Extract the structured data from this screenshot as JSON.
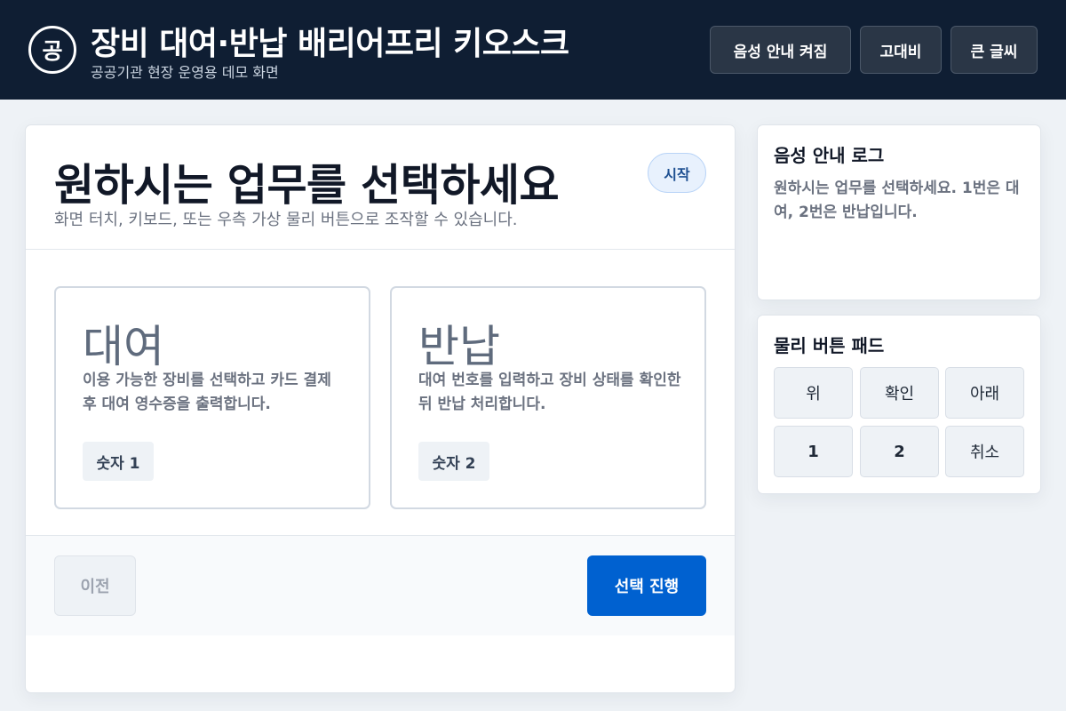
{
  "header": {
    "logo_text": "공",
    "title": "장비 대여·반납 배리어프리 키오스크",
    "subtitle": "공공기관 현장 운영용 데모 화면",
    "buttons": [
      {
        "label": "음성 안내 켜짐"
      },
      {
        "label": "고대비"
      },
      {
        "label": "큰 글씨"
      }
    ]
  },
  "main": {
    "heading": "원하시는 업무를 선택하세요",
    "subheading": "화면 터치, 키보드, 또는 우측 가상 물리 버튼으로 조작할 수 있습니다.",
    "status_badge": "시작",
    "options": [
      {
        "title": "대여",
        "description": "이용 가능한 장비를 선택하고 카드 결제 후 대여 영수증을 출력합니다.",
        "key_label": "숫자 1"
      },
      {
        "title": "반납",
        "description": "대여 번호를 입력하고 장비 상태를 확인한 뒤 반납 처리합니다.",
        "key_label": "숫자 2"
      }
    ],
    "prev_button": "이전",
    "next_button": "선택 진행"
  },
  "voice_log": {
    "title": "음성 안내 로그",
    "message": "원하시는 업무를 선택하세요. 1번은 대여, 2번은 반납입니다."
  },
  "button_pad": {
    "title": "물리 버튼 패드",
    "buttons": [
      {
        "label": "위"
      },
      {
        "label": "확인"
      },
      {
        "label": "아래"
      },
      {
        "label": "1"
      },
      {
        "label": "2"
      },
      {
        "label": "취소"
      }
    ]
  },
  "colors": {
    "header_bg": "#0f1e33",
    "primary": "#0061d0",
    "badge_bg": "#e8f1fd",
    "page_bg": "#eef2f6"
  }
}
